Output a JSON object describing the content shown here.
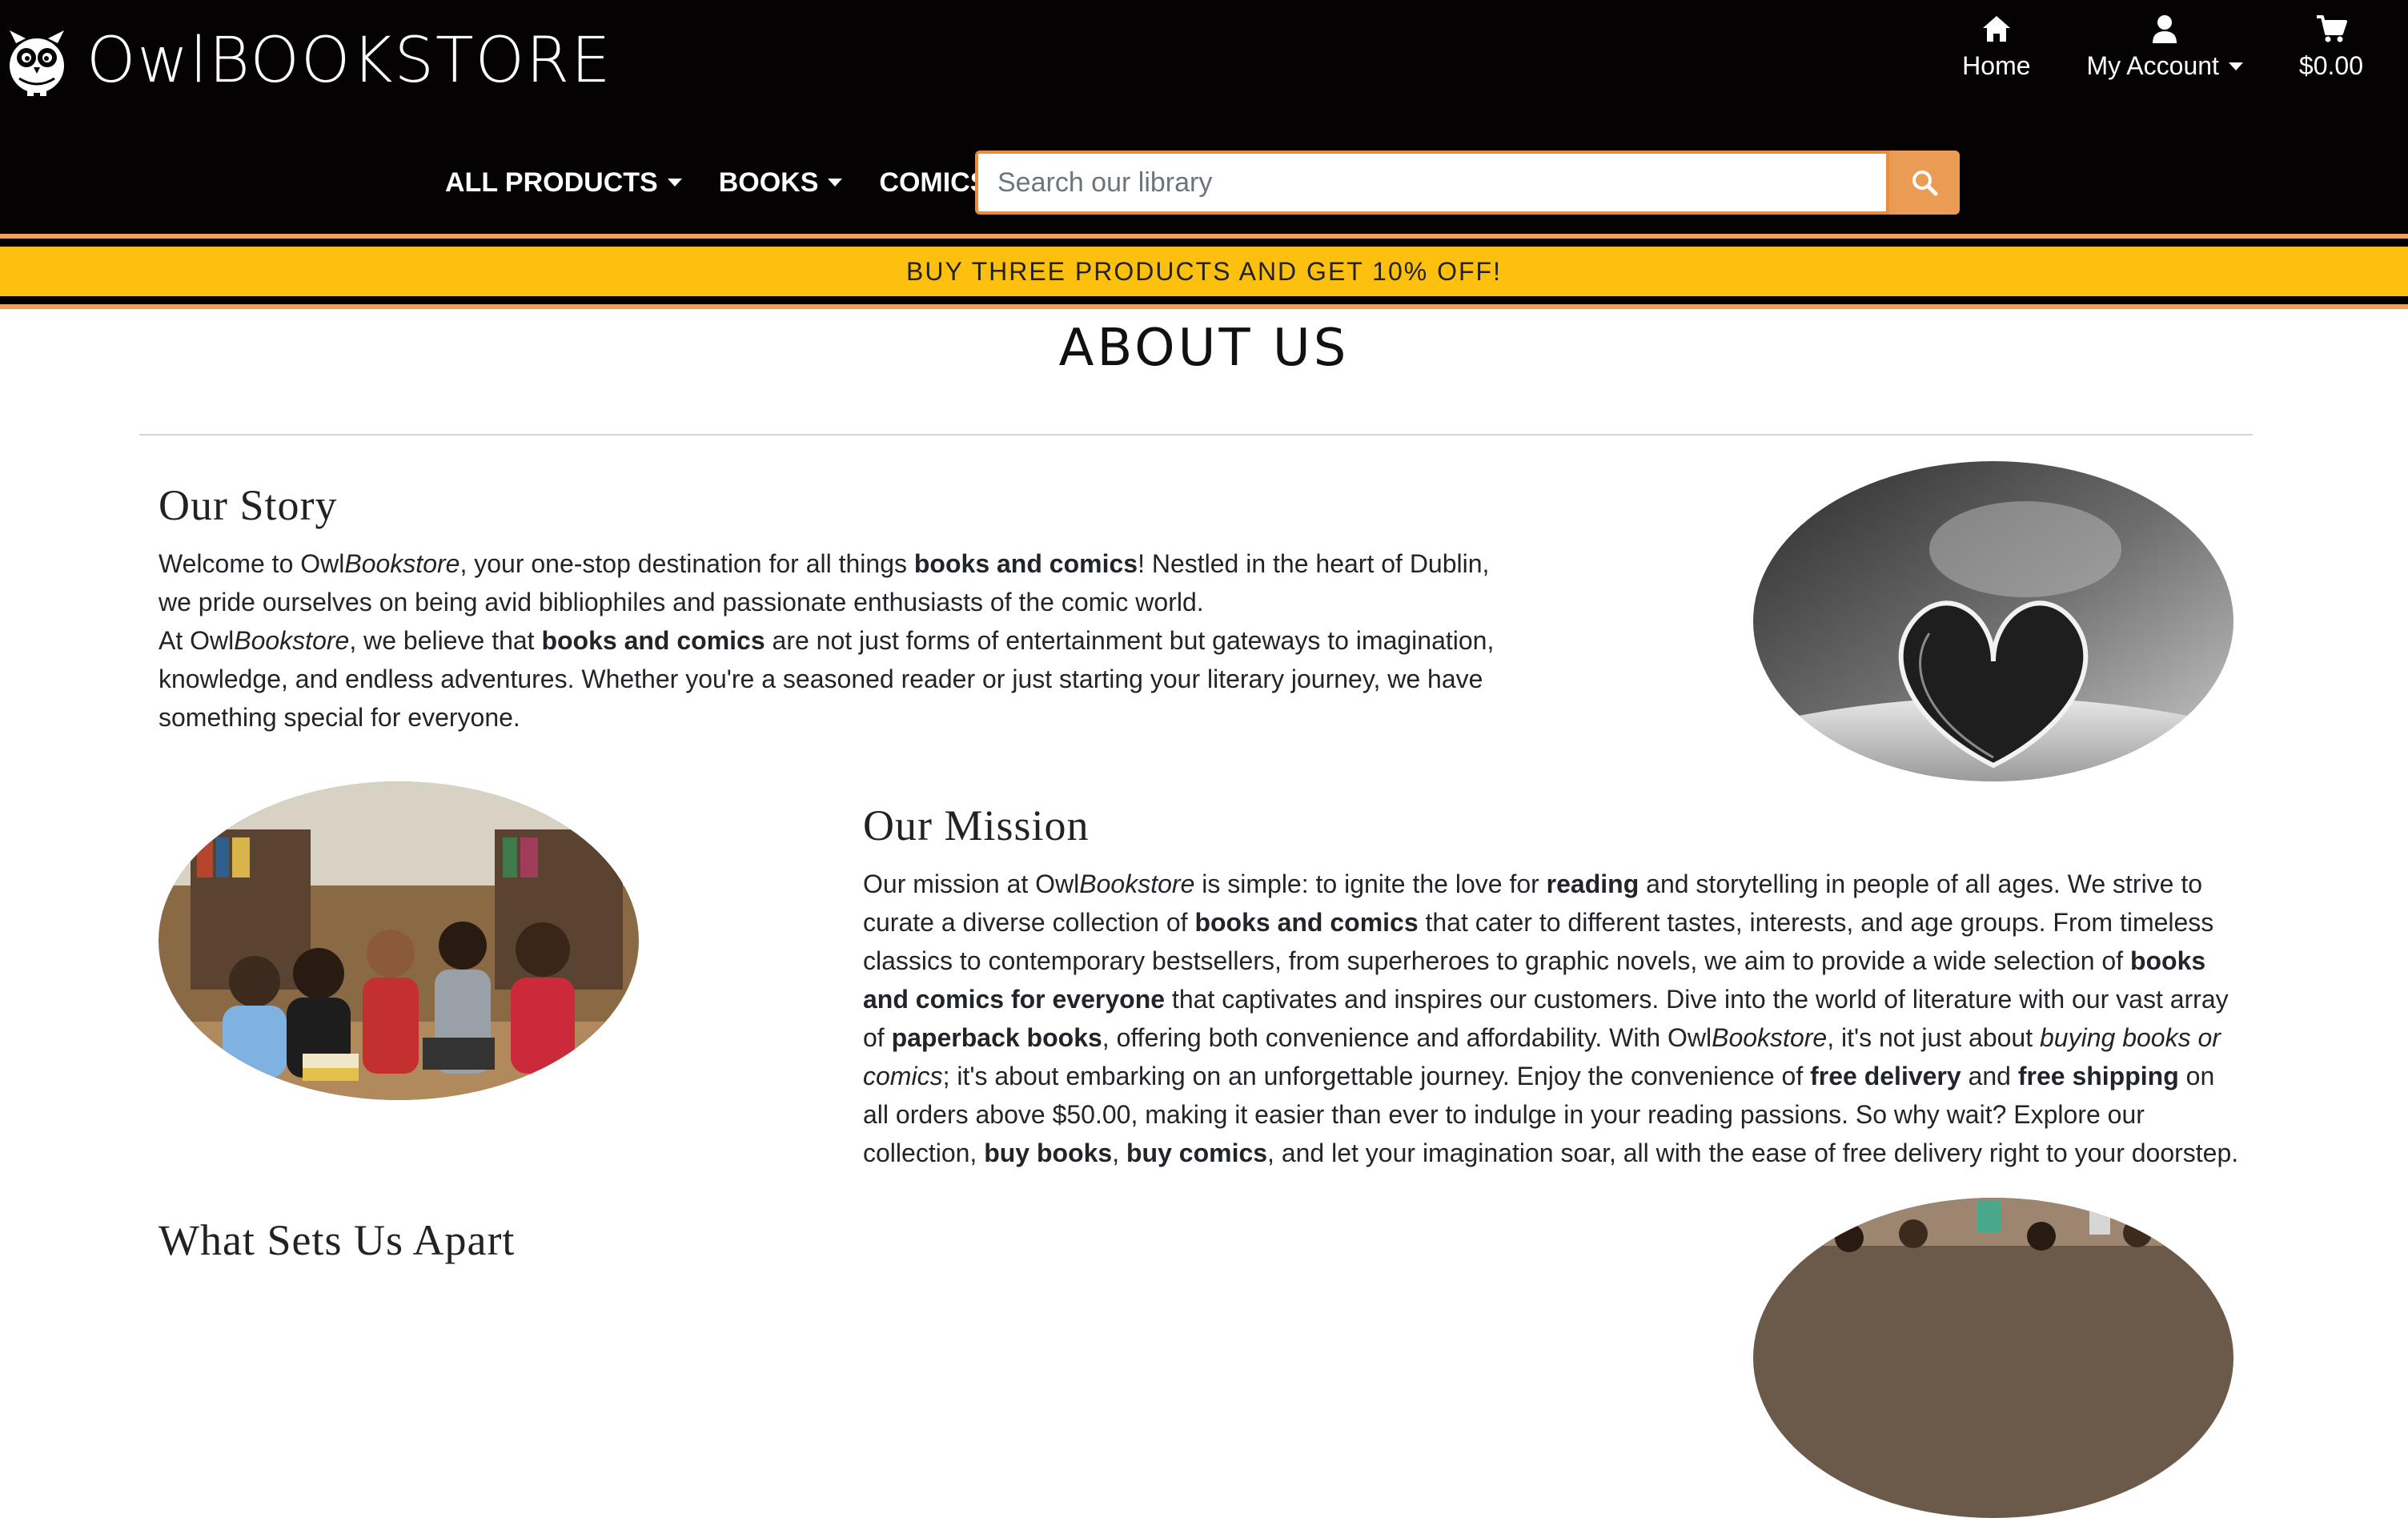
{
  "header": {
    "logo_text": "OwlBOOKSTORE",
    "top_nav": {
      "home_label": "Home",
      "account_label": "My Account",
      "cart_total": "$0.00"
    },
    "main_nav": {
      "all_products": "ALL PRODUCTS",
      "books": "BOOKS",
      "comics": "COMICS"
    },
    "search": {
      "placeholder": "Search our library",
      "value": ""
    }
  },
  "promo": {
    "text": "BUY THREE PRODUCTS AND GET 10% OFF!"
  },
  "page": {
    "title": "ABOUT US"
  },
  "story": {
    "title": "Our Story",
    "p1_a": "Welcome to Owl",
    "p1_brand": "Bookstore",
    "p1_b": ", your one-stop destination for all things ",
    "p1_bold": "books and comics",
    "p1_c": "! Nestled in the heart of Dublin, we pride ourselves on being avid bibliophiles and passionate enthusiasts of the comic world.",
    "p2_a": "At Owl",
    "p2_brand": "Bookstore",
    "p2_b": ", we believe that ",
    "p2_bold": "books and comics",
    "p2_c": " are not just forms of entertainment but gateways to imagination, knowledge, and endless adventures. Whether you're a seasoned reader or just starting your literary journey, we have something special for everyone."
  },
  "mission": {
    "title": "Our Mission",
    "t1": "Our mission at Owl",
    "t1_brand": "Bookstore",
    "t2": " is simple: to ignite the love for ",
    "b1": "reading",
    "t3": " and storytelling in people of all ages. We strive to curate a diverse collection of ",
    "b2": "books and comics",
    "t4": " that cater to different tastes, interests, and age groups. From timeless classics to contemporary bestsellers, from superheroes to graphic novels, we aim to provide a wide selection of ",
    "b3": "books and comics for everyone",
    "t5": " that captivates and inspires our customers. Dive into the world of literature with our vast array of ",
    "b4": "paperback books",
    "t6": ", offering both convenience and affordability. With Owl",
    "t6_brand": "Bookstore",
    "t7": ", it's not just about ",
    "i1": "buying books or comics",
    "t8": "; it's about embarking on an unforgettable journey. Enjoy the convenience of ",
    "b5": "free delivery",
    "t9": " and ",
    "b6": "free shipping",
    "t10": " on all orders above $50.00, making it easier than ever to indulge in your reading passions. So why wait? Explore our collection, ",
    "b7": "buy books",
    "t11": ", ",
    "b8": "buy comics",
    "t12": ", and let your imagination soar, all with the ease of free delivery right to your doorstep."
  },
  "apart": {
    "title": "What Sets Us Apart"
  },
  "icons": {
    "logo": "owl-logo-icon",
    "home": "home-icon",
    "account": "user-icon",
    "cart": "cart-icon",
    "search": "search-icon"
  },
  "colors": {
    "header_bg": "#050203",
    "accent_orange": "#eb9c54",
    "promo_yellow": "#fdc00e"
  }
}
